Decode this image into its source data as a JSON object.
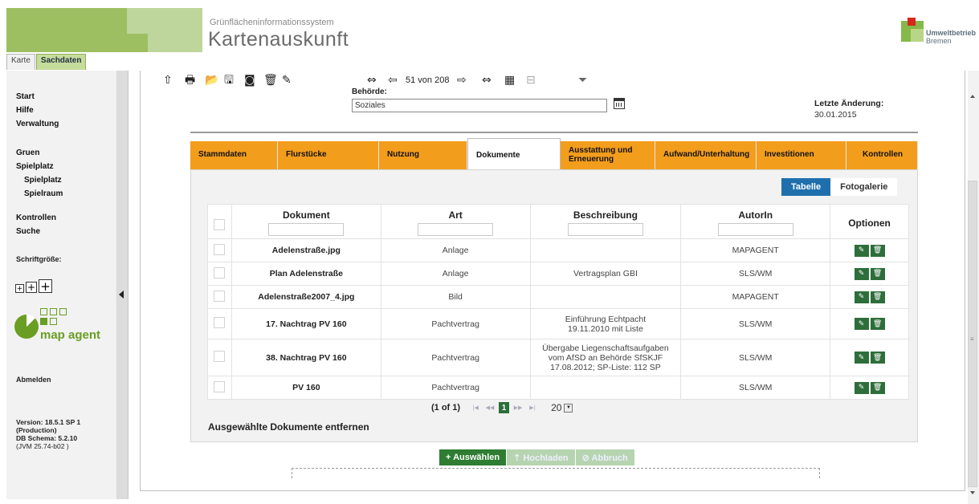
{
  "header": {
    "system_subtitle": "Grünflächeninformationssystem",
    "system_title": "Kartenauskunft",
    "org_name_line1": "Umweltbetrieb",
    "org_name_line2": "Bremen"
  },
  "top_tabs": [
    {
      "label": "Karte",
      "active": false
    },
    {
      "label": "Sachdaten",
      "active": true
    }
  ],
  "sidebar": {
    "nav_group1": [
      "Start",
      "Hilfe",
      "Verwaltung"
    ],
    "nav_group2": [
      "Gruen",
      "Spielplatz"
    ],
    "nav_group2_sub": [
      "Spielplatz",
      "Spielraum"
    ],
    "nav_group3": [
      "Kontrollen",
      "Suche"
    ],
    "font_size_label": "Schriftgröße:",
    "font_size_buttons": [
      "+",
      "+",
      "+"
    ],
    "logo_text": "map agent",
    "logout": "Abmelden",
    "version_lines": [
      "Version: 18.5.1 SP 1",
      "(Production)",
      "DB Schema: 5.2.10",
      "(JVM 25.74-b02 )"
    ]
  },
  "toolbar": {
    "record_counter": "51 von 208",
    "icons": [
      "upload-icon",
      "print-icon",
      "open-folder-icon",
      "save-icon",
      "discard-icon",
      "delete-icon",
      "edit-icon",
      "first-record-icon",
      "prev-record-icon",
      "next-record-icon",
      "last-record-icon",
      "table-icon",
      "export-icon",
      "filter-icon"
    ]
  },
  "record": {
    "behoerde_label": "Behörde:",
    "behoerde_value": "Soziales",
    "last_change_label": "Letzte Änderung:",
    "last_change_value": "30.01.2015"
  },
  "detail_tabs": [
    {
      "label": "Stammdaten",
      "active": false
    },
    {
      "label": "Flurstücke",
      "active": false
    },
    {
      "label": "Nutzung",
      "active": false
    },
    {
      "label": "Dokumente",
      "active": true
    },
    {
      "label": "Ausstattung und Erneuerung",
      "active": false
    },
    {
      "label": "Aufwand/Unterhaltung",
      "active": false
    },
    {
      "label": "Investitionen",
      "active": false
    },
    {
      "label": "Kontrollen",
      "active": false
    }
  ],
  "view_toggle": {
    "table": "Tabelle",
    "gallery": "Fotogalerie"
  },
  "documents": {
    "columns": [
      "Dokument",
      "Art",
      "Beschreibung",
      "AutorIn",
      "Optionen"
    ],
    "rows": [
      {
        "dokument": "Adelenstraße.jpg",
        "art": "Anlage",
        "beschreibung": "",
        "autorin": "MAPAGENT"
      },
      {
        "dokument": "Plan Adelenstraße",
        "art": "Anlage",
        "beschreibung": "Vertragsplan GBI",
        "autorin": "SLS/WM"
      },
      {
        "dokument": "Adelenstraße2007_4.jpg",
        "art": "Bild",
        "beschreibung": "",
        "autorin": "MAPAGENT"
      },
      {
        "dokument": "17. Nachtrag PV 160",
        "art": "Pachtvertrag",
        "beschreibung": "Einführung Echtpacht 19.11.2010 mit Liste",
        "autorin": "SLS/WM"
      },
      {
        "dokument": "38. Nachtrag PV 160",
        "art": "Pachtvertrag",
        "beschreibung": "Übergabe Liegenschaftsaufgaben vom AfSD an Behörde SfSKJF 17.08.2012; SP-Liste: 112 SP",
        "autorin": "SLS/WM"
      },
      {
        "dokument": "PV 160",
        "art": "Pachtvertrag",
        "beschreibung": "",
        "autorin": "SLS/WM"
      }
    ]
  },
  "pager": {
    "info": "(1 of 1)",
    "current_page": "1",
    "page_size": "20"
  },
  "actions": {
    "remove_selected": "Ausgewählte Dokumente entfernen",
    "choose": "+ Auswählen",
    "upload": "Hochladen",
    "cancel": "Abbruch"
  }
}
